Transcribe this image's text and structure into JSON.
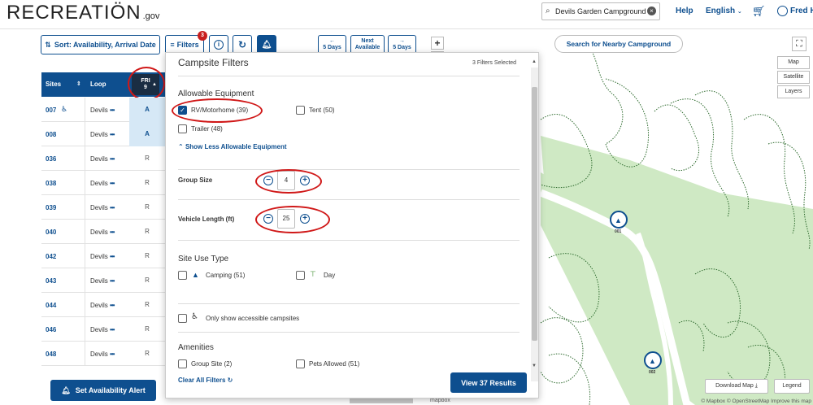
{
  "header": {
    "logo_main": "RECREATI",
    "logo_o": "Ö",
    "logo_n": "N",
    "logo_gov": ".gov",
    "search_value": "Devils Garden Campground",
    "help": "Help",
    "language": "English",
    "user": "Fred H"
  },
  "toolbar": {
    "sort_label": "Sort:  Availability, Arrival Date",
    "filters_label": "Filters",
    "filters_badge": "3",
    "prev_label_1": "←",
    "prev_label_2": "5 Days",
    "next_avail_1": "Next",
    "next_avail_2": "Available",
    "next_label_1": "→",
    "next_label_2": "5 Days"
  },
  "grid": {
    "col_sites": "Sites",
    "col_loop": "Loop",
    "fri_day": "FRI",
    "fri_date": "9",
    "rows": [
      {
        "site": "007",
        "loop": "Devils",
        "avail": "A",
        "accessible": true
      },
      {
        "site": "008",
        "loop": "Devils",
        "avail": "A",
        "accessible": false
      },
      {
        "site": "036",
        "loop": "Devils",
        "avail": "R",
        "accessible": false
      },
      {
        "site": "038",
        "loop": "Devils",
        "avail": "R",
        "accessible": false
      },
      {
        "site": "039",
        "loop": "Devils",
        "avail": "R",
        "accessible": false
      },
      {
        "site": "040",
        "loop": "Devils",
        "avail": "R",
        "accessible": false
      },
      {
        "site": "042",
        "loop": "Devils",
        "avail": "R",
        "accessible": false
      },
      {
        "site": "043",
        "loop": "Devils",
        "avail": "R",
        "accessible": false
      },
      {
        "site": "044",
        "loop": "Devils",
        "avail": "R",
        "accessible": false
      },
      {
        "site": "046",
        "loop": "Devils",
        "avail": "R",
        "accessible": false
      },
      {
        "site": "048",
        "loop": "Devils",
        "avail": "R",
        "accessible": false
      }
    ],
    "alert_button": "Set Availability Alert"
  },
  "filters": {
    "title": "Campsite Filters",
    "selected_count": "3 Filters Selected",
    "equipment_title": "Allowable Equipment",
    "rv_label": "RV/Motorhome (39)",
    "tent_label": "Tent (50)",
    "trailer_label": "Trailer (48)",
    "show_less": "Show Less Allowable Equipment",
    "group_size_label": "Group Size",
    "group_size_value": "4",
    "vehicle_length_label": "Vehicle Length (ft)",
    "vehicle_length_value": "25",
    "site_use_title": "Site Use Type",
    "camping_label": "Camping (51)",
    "day_label": "Day",
    "accessible_label": "Only show accessible campsites",
    "amenities_title": "Amenities",
    "group_site_label": "Group Site (2)",
    "pets_label": "Pets Allowed (51)",
    "clear_all": "Clear All Filters",
    "view_results": "View 37 Results"
  },
  "map": {
    "nearby_button": "Search for Nearby Campground",
    "map_label": "Map",
    "satellite_label": "Satellite",
    "layers_label": "Layers",
    "download_map": "Download Map",
    "legend": "Legend",
    "marker_1": "001",
    "marker_2": "002",
    "attribution": "© Mapbox © OpenStreetMap Improve this map",
    "mapbox_logo": "mapbox"
  },
  "colors": {
    "brand": "#0e4f8f",
    "highlight_ring": "#d01818",
    "available": "#d6e8f6",
    "map_green": "#cfe9c4",
    "contour": "#2e6b2e"
  }
}
